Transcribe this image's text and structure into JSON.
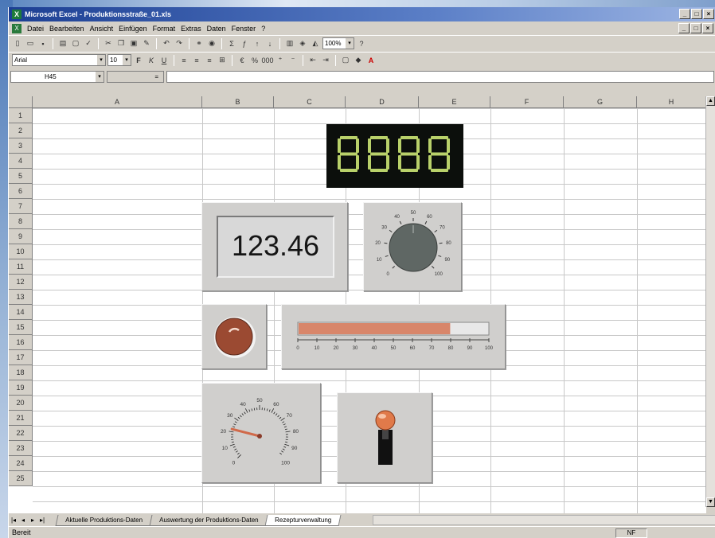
{
  "window": {
    "title": "Microsoft Excel - Produktionsstraße_01.xls",
    "app_icon": "X"
  },
  "menu": {
    "items": [
      "Datei",
      "Bearbeiten",
      "Ansicht",
      "Einfügen",
      "Format",
      "Extras",
      "Daten",
      "Fenster",
      "?"
    ]
  },
  "toolbar": {
    "zoom": "100%",
    "font_name": "Arial",
    "font_size": "10"
  },
  "formula_bar": {
    "name_box": "H45",
    "fx_label": "="
  },
  "columns": [
    "A",
    "B",
    "C",
    "D",
    "E",
    "F",
    "G",
    "H"
  ],
  "rows": [
    "1",
    "2",
    "3",
    "4",
    "5",
    "6",
    "7",
    "8",
    "9",
    "10",
    "11",
    "12",
    "13",
    "14",
    "15",
    "16",
    "17",
    "18",
    "19",
    "20",
    "21",
    "22",
    "23",
    "24",
    "25"
  ],
  "controls": {
    "led_display": {
      "value": "8888",
      "color": "#b9d16a"
    },
    "numeric_display": {
      "value": "123.46"
    },
    "knob": {
      "value_fraction": 0.5,
      "scale_labels": [
        "0",
        "10",
        "20",
        "30",
        "40",
        "50",
        "60",
        "70",
        "80",
        "90",
        "100"
      ]
    },
    "led_indicator": {
      "color": "#9b4a32"
    },
    "slider": {
      "value_fraction": 0.8,
      "scale_labels": [
        "0",
        "10",
        "20",
        "30",
        "40",
        "50",
        "60",
        "70",
        "80",
        "90",
        "100"
      ],
      "fill_color": "#d8866a"
    },
    "gauge": {
      "value_fraction": 0.22,
      "scale_labels": [
        "0",
        "10",
        "20",
        "30",
        "40",
        "50",
        "60",
        "70",
        "80",
        "90",
        "100"
      ]
    },
    "toggle_switch": {
      "state": "on",
      "knob_color": "#e07a4a"
    }
  },
  "sheet_tabs": {
    "tabs": [
      "Aktuelle Produktions-Daten",
      "Auswertung der Produktions-Daten",
      "Rezepturverwaltung"
    ],
    "active_index": 2
  },
  "status": {
    "text": "Bereit",
    "indicator": "NF"
  }
}
